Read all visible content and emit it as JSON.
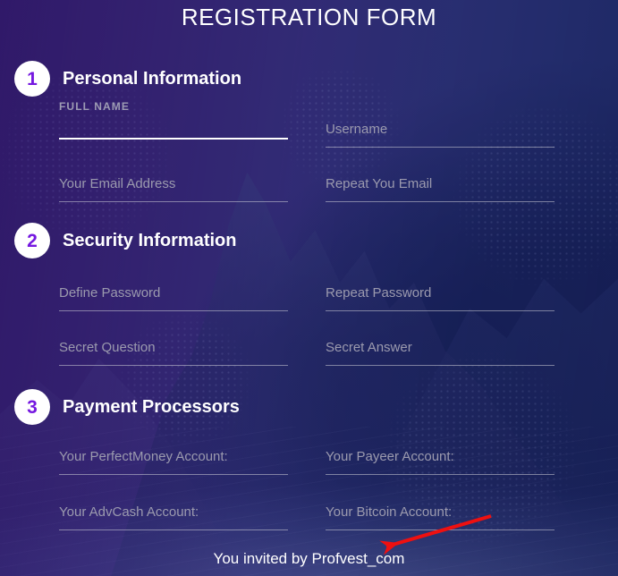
{
  "page": {
    "title": "REGISTRATION FORM",
    "accent_purple": "#7518e0",
    "badge_bg": "#ffffff",
    "text_white": "#ffffff",
    "placeholder_gray": "#9b9aae",
    "annotation_red": "#ef1010",
    "bg_gradient_from": "#4c2f86",
    "bg_gradient_to": "#2d3c7e"
  },
  "sections": [
    {
      "number": "1",
      "title": "Personal Information",
      "label": "FULL NAME",
      "fields": [
        {
          "name": "full-name",
          "placeholder": "",
          "value": "",
          "focused": true
        },
        {
          "name": "username",
          "placeholder": "Username",
          "value": "",
          "focused": false
        },
        {
          "name": "email",
          "placeholder": "Your Email Address",
          "value": "",
          "focused": false
        },
        {
          "name": "repeat-email",
          "placeholder": "Repeat You Email",
          "value": "",
          "focused": false
        }
      ]
    },
    {
      "number": "2",
      "title": "Security Information",
      "fields": [
        {
          "name": "define-password",
          "placeholder": "Define Password",
          "value": "",
          "focused": false
        },
        {
          "name": "repeat-password",
          "placeholder": "Repeat Password",
          "value": "",
          "focused": false
        },
        {
          "name": "secret-question",
          "placeholder": "Secret Question",
          "value": "",
          "focused": false
        },
        {
          "name": "secret-answer",
          "placeholder": "Secret Answer",
          "value": "",
          "focused": false
        }
      ]
    },
    {
      "number": "3",
      "title": "Payment Processors",
      "fields": [
        {
          "name": "perfectmoney-account",
          "placeholder": "Your PerfectMoney Account:",
          "value": "",
          "focused": false
        },
        {
          "name": "payeer-account",
          "placeholder": "Your Payeer Account:",
          "value": "",
          "focused": false
        },
        {
          "name": "advcash-account",
          "placeholder": "Your AdvCash Account:",
          "value": "",
          "focused": false
        },
        {
          "name": "bitcoin-account",
          "placeholder": "Your Bitcoin Account:",
          "value": "",
          "focused": false
        }
      ]
    }
  ],
  "footer": {
    "invite_text": "You invited by Profvest_com"
  },
  "annotation": {
    "arrow_color": "#ef1010",
    "points_to": "You invited by Profvest_com"
  }
}
